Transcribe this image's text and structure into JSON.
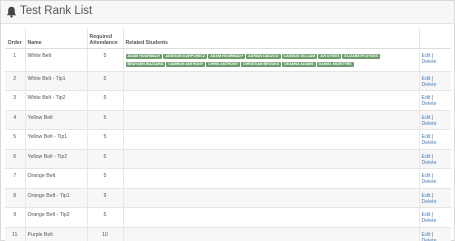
{
  "page": {
    "title": "Test Rank List",
    "icon": "bell-icon"
  },
  "table": {
    "headers": {
      "order": "Order",
      "name": "Name",
      "attendance": "Required Attendance",
      "students": "Related Students"
    },
    "edit_label": "Edit",
    "delete_label": "Delete",
    "separator": "|",
    "rows": [
      {
        "order": "1",
        "name": "White Belt",
        "attendance": "5",
        "students": [
          "ADAM HOURMADY",
          "ADDISON KARPOWICZ",
          "ADAM HOURMADY",
          "ADRIAN DADZCO",
          "CASSIUS GILLIAM",
          "AVI DYKES",
          "ELIZABETH DYKES",
          "BRAYDEN BUZZARD",
          "CAMRON ANTHONY",
          "CHRIS ANTHONY",
          "CHRISTIAN BROOKS",
          "DEANNA ADAMS",
          "DANIEL MCINTYRE"
        ]
      },
      {
        "order": "2",
        "name": "White Belt - Tip1",
        "attendance": "5",
        "students": []
      },
      {
        "order": "3",
        "name": "White Belt - Tip2",
        "attendance": "5",
        "students": []
      },
      {
        "order": "4",
        "name": "Yellow Belt",
        "attendance": "5",
        "students": []
      },
      {
        "order": "5",
        "name": "Yellow Belt - Tip1",
        "attendance": "5",
        "students": []
      },
      {
        "order": "6",
        "name": "Yellow Belt - Tip2",
        "attendance": "5",
        "students": []
      },
      {
        "order": "7",
        "name": "Orange Belt",
        "attendance": "5",
        "students": []
      },
      {
        "order": "8",
        "name": "Orange Belt - Tip1",
        "attendance": "9",
        "students": []
      },
      {
        "order": "9",
        "name": "Orange Belt - Tip2",
        "attendance": "5",
        "students": []
      },
      {
        "order": "11",
        "name": "Purple Belt",
        "attendance": "10",
        "students": []
      }
    ]
  },
  "colors": {
    "badge": "#6c9e6c",
    "link": "#4a7fb5"
  }
}
